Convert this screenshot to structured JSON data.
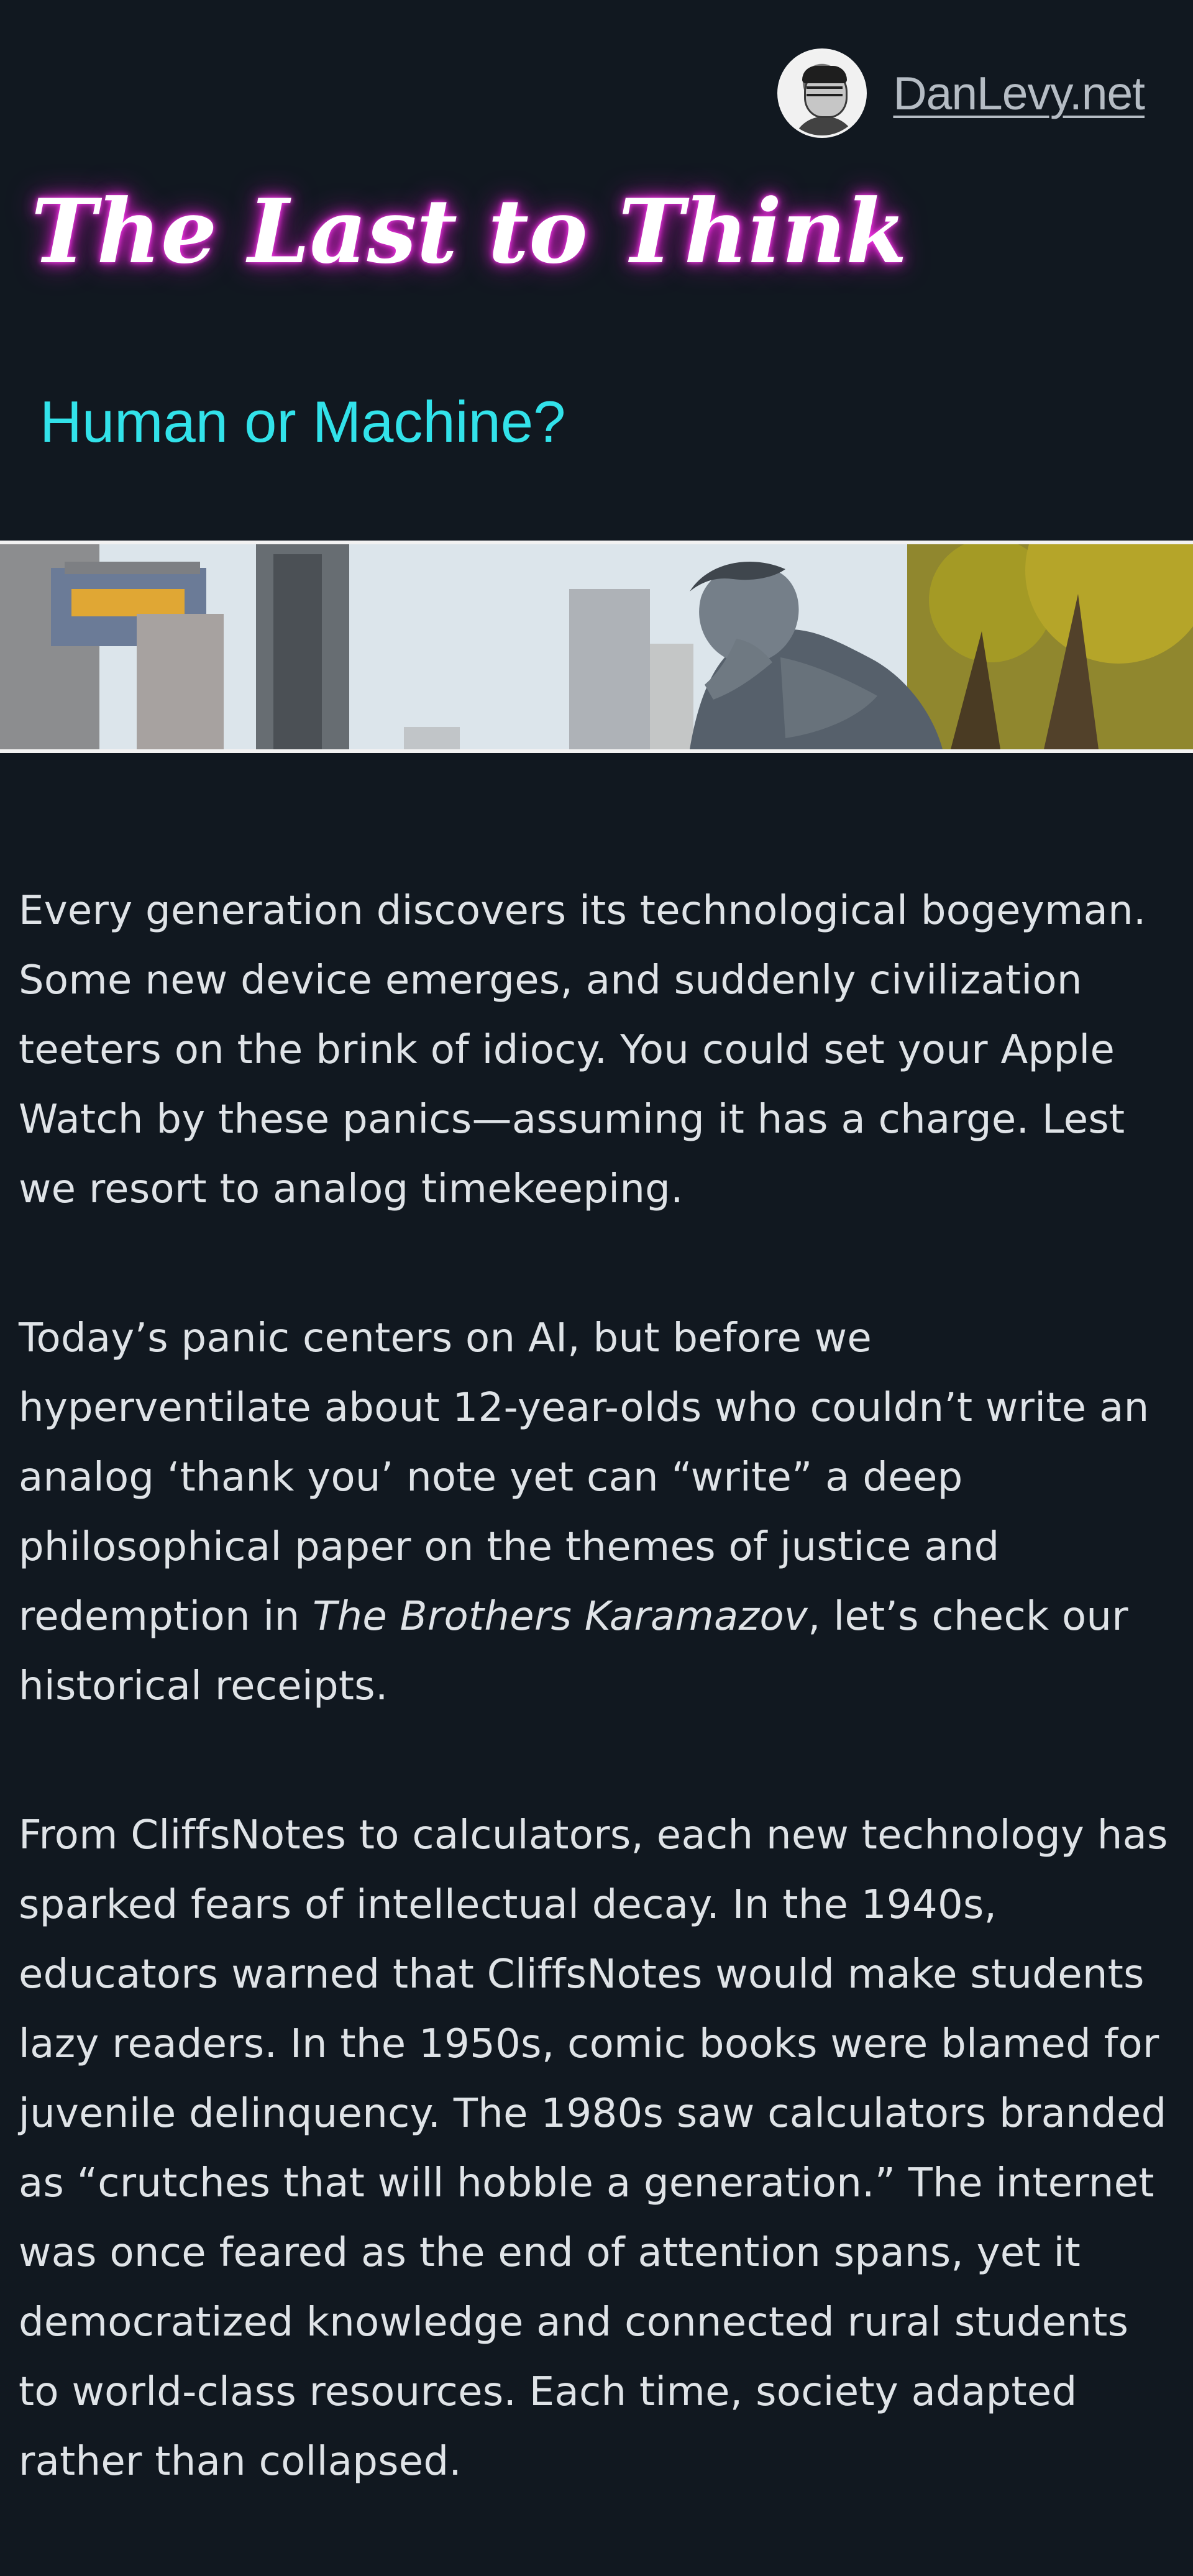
{
  "header": {
    "site_name": "DanLevy.net",
    "title": "The Last to Think",
    "subtitle": "Human or Machine?"
  },
  "banner": {
    "icon": "thinker-statue-city-banner"
  },
  "article": {
    "p1": "Every generation discovers its technological bogeyman. Some new device emerges, and suddenly civilization teeters on the brink of idiocy. You could set your Apple Watch by these panics—assuming it has a charge. Lest we resort to analog timekeeping.",
    "p2_before": "Today’s panic centers on AI, but before we hyperventilate about 12-year-olds who couldn’t write an analog ‘thank you’ note yet can “write” a deep philosophical paper on the themes of justice and redemption in ",
    "p2_title": "The Brothers Karamazov",
    "p2_after": ", let’s check our historical receipts.",
    "p3": "From CliffsNotes to calculators, each new technology has sparked fears of intellectual decay. In the 1940s, educators warned that CliffsNotes would make students lazy readers. In the 1950s, comic books were blamed for juvenile delinquency. The 1980s saw calculators branded as “crutches that will hobble a generation.” The internet was once feared as the end of attention spans, yet it democratized knowledge and connected rural students to world-class resources. Each time, society adapted rather than collapsed."
  },
  "colors": {
    "background": "#111820",
    "title_glow": "#e226d3",
    "subtitle": "#32e2ea",
    "link": "#b5bcc4"
  }
}
